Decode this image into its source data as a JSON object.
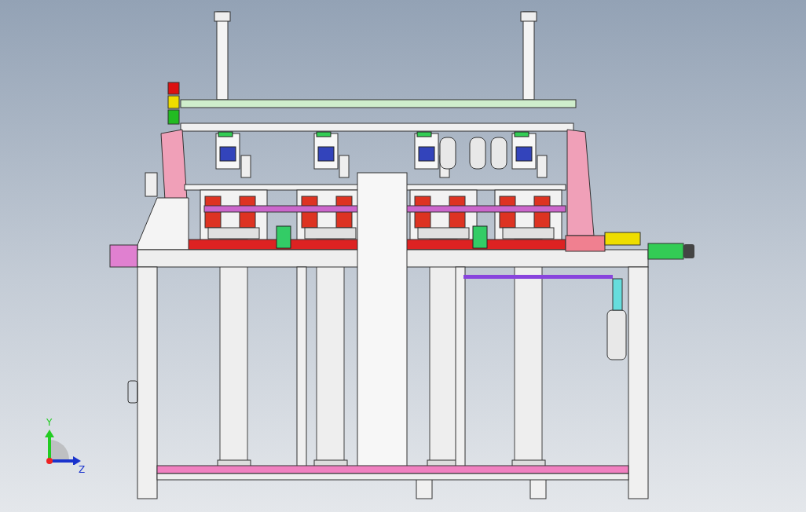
{
  "viewport": {
    "triad": {
      "axes": [
        {
          "kind": "y",
          "label": "Y"
        },
        {
          "kind": "z",
          "label": "Z"
        }
      ]
    }
  }
}
